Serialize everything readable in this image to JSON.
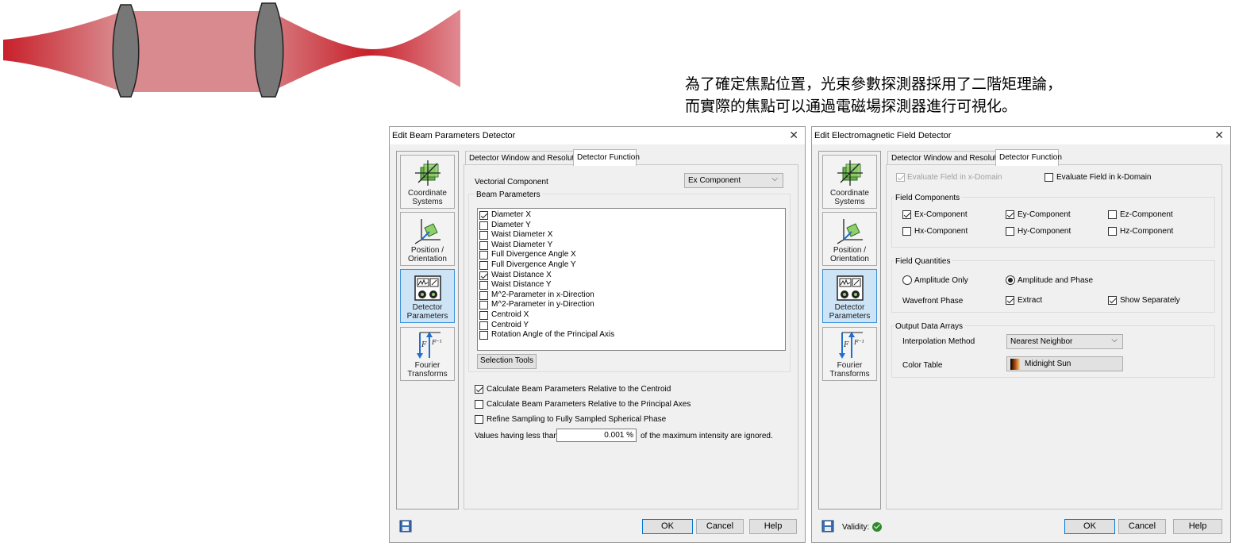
{
  "caption": {
    "line1": "為了確定焦點位置，光束參數探測器採用了二階矩理論，",
    "line2": "而實際的焦點可以通過電磁場探測器進行可視化。"
  },
  "colors": {
    "beam_red": "#c8202a",
    "lens_gray": "#777777",
    "selected_nav": "#cde4f7",
    "validity_green": "#2e8b2e"
  },
  "nav_items": [
    {
      "label": "Coordinate Systems",
      "icon": "coordinate-systems-icon"
    },
    {
      "label": "Position / Orientation",
      "icon": "position-orientation-icon"
    },
    {
      "label": "Detector Parameters",
      "icon": "detector-parameters-icon"
    },
    {
      "label": "Fourier Transforms",
      "icon": "fourier-transforms-icon"
    }
  ],
  "beam_dialog": {
    "title": "Edit Beam Parameters Detector",
    "tabs": [
      "Detector Window and Resolution",
      "Detector Function"
    ],
    "active_tab": "Detector Function",
    "vectorial_component_label": "Vectorial Component",
    "vectorial_component_value": "Ex Component",
    "beam_parameters_group": "Beam Parameters",
    "beam_parameters": [
      {
        "label": "Diameter X",
        "checked": true
      },
      {
        "label": "Diameter Y",
        "checked": false
      },
      {
        "label": "Waist Diameter X",
        "checked": false
      },
      {
        "label": "Waist Diameter Y",
        "checked": false
      },
      {
        "label": "Full Divergence Angle X",
        "checked": false
      },
      {
        "label": "Full Divergence Angle Y",
        "checked": false
      },
      {
        "label": "Waist Distance X",
        "checked": true
      },
      {
        "label": "Waist Distance Y",
        "checked": false
      },
      {
        "label": "M^2-Parameter in x-Direction",
        "checked": false
      },
      {
        "label": "M^2-Parameter in y-Direction",
        "checked": false
      },
      {
        "label": "Centroid X",
        "checked": false
      },
      {
        "label": "Centroid Y",
        "checked": false
      },
      {
        "label": "Rotation Angle of the Principal Axis",
        "checked": false
      }
    ],
    "selection_tools_label": "Selection Tools",
    "options": [
      {
        "label": "Calculate Beam Parameters Relative to the Centroid",
        "checked": true
      },
      {
        "label": "Calculate Beam Parameters Relative to the Principal Axes",
        "checked": false
      },
      {
        "label": "Refine Sampling to Fully Sampled Spherical Phase",
        "checked": false
      }
    ],
    "threshold_prefix": "Values having less than",
    "threshold_value": "0.001 %",
    "threshold_suffix": "of the maximum intensity are ignored.",
    "buttons": {
      "ok": "OK",
      "cancel": "Cancel",
      "help": "Help"
    }
  },
  "em_dialog": {
    "title": "Edit Electromagnetic Field Detector",
    "tabs": [
      "Detector Window and Resolution",
      "Detector Function"
    ],
    "active_tab": "Detector Function",
    "evaluate_x": {
      "label": "Evaluate Field in x-Domain",
      "checked": true,
      "disabled": true
    },
    "evaluate_k": {
      "label": "Evaluate Field in k-Domain",
      "checked": false
    },
    "field_components_group": "Field Components",
    "field_components": [
      {
        "label": "Ex-Component",
        "checked": true
      },
      {
        "label": "Ey-Component",
        "checked": true
      },
      {
        "label": "Ez-Component",
        "checked": false
      },
      {
        "label": "Hx-Component",
        "checked": false
      },
      {
        "label": "Hy-Component",
        "checked": false
      },
      {
        "label": "Hz-Component",
        "checked": false
      }
    ],
    "field_quantities_group": "Field Quantities",
    "amplitude_only": {
      "label": "Amplitude Only",
      "selected": false
    },
    "amplitude_phase": {
      "label": "Amplitude and Phase",
      "selected": true
    },
    "wavefront_phase_label": "Wavefront Phase",
    "extract": {
      "label": "Extract",
      "checked": true
    },
    "show_separately": {
      "label": "Show Separately",
      "checked": true
    },
    "output_group": "Output Data Arrays",
    "interpolation_label": "Interpolation Method",
    "interpolation_value": "Nearest Neighbor",
    "color_table_label": "Color Table",
    "color_table_value": "Midnight Sun",
    "validity_label": "Validity:",
    "buttons": {
      "ok": "OK",
      "cancel": "Cancel",
      "help": "Help"
    }
  }
}
